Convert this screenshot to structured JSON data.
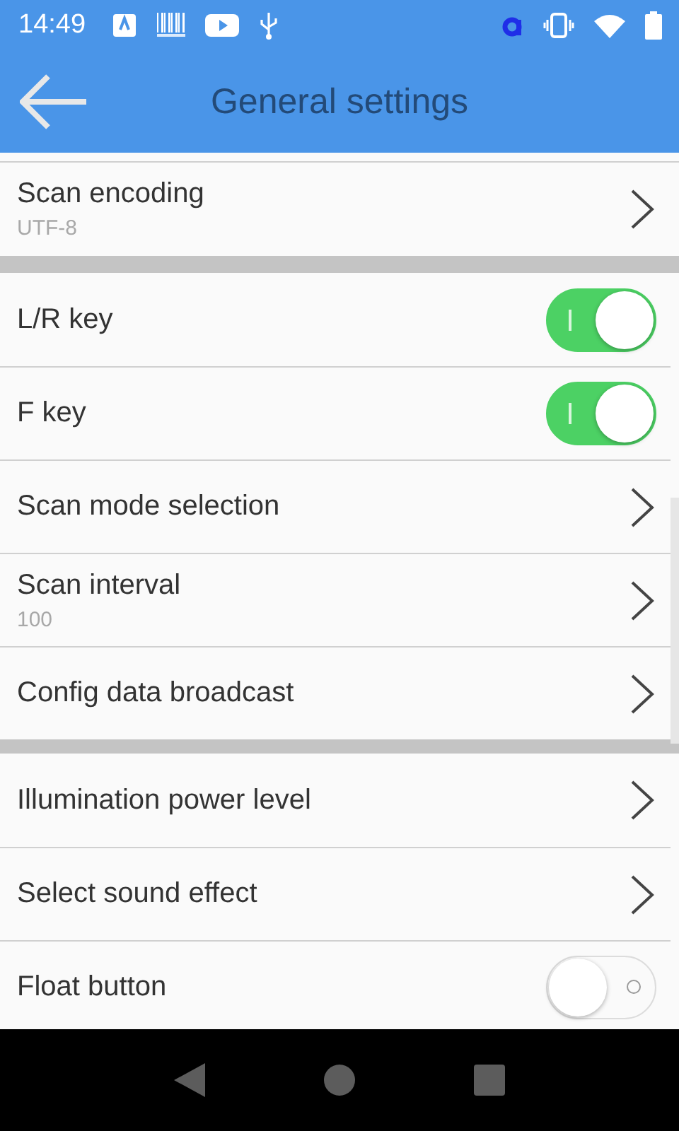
{
  "status_bar": {
    "time": "14:49"
  },
  "app_bar": {
    "title": "General settings"
  },
  "sections": [
    {
      "items": [
        {
          "kind": "link",
          "title": "Scan encoding",
          "subtitle": "UTF-8"
        }
      ]
    },
    {
      "items": [
        {
          "kind": "switch",
          "title": "L/R key",
          "on": true
        },
        {
          "kind": "switch",
          "title": "F key",
          "on": true
        },
        {
          "kind": "link",
          "title": "Scan mode selection"
        },
        {
          "kind": "link",
          "title": "Scan interval",
          "subtitle": "100"
        },
        {
          "kind": "link",
          "title": "Config data broadcast"
        }
      ]
    },
    {
      "items": [
        {
          "kind": "link",
          "title": "Illumination power level"
        },
        {
          "kind": "link",
          "title": "Select sound effect"
        },
        {
          "kind": "switch",
          "title": "Float button",
          "on": false
        }
      ]
    }
  ]
}
